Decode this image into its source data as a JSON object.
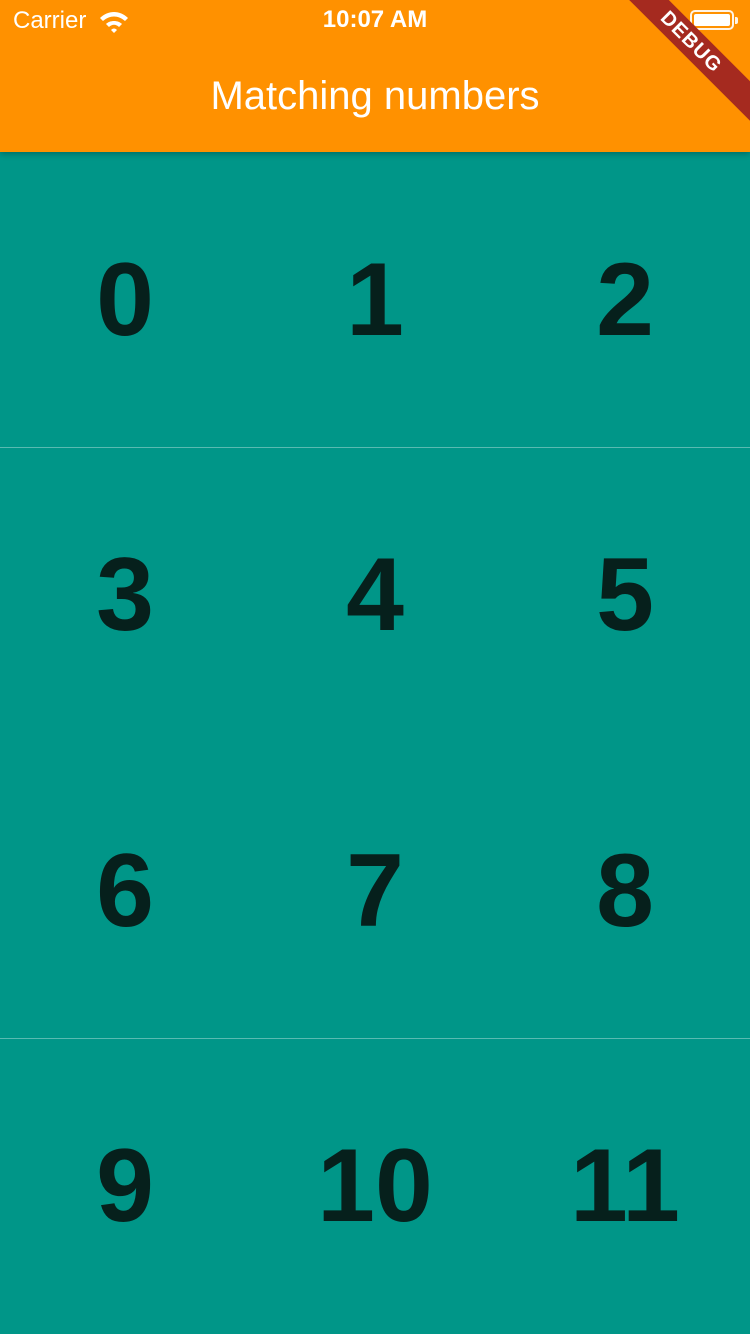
{
  "status_bar": {
    "carrier": "Carrier",
    "time": "10:07 AM",
    "wifi_icon": "wifi-icon",
    "battery_icon": "battery-icon"
  },
  "app_bar": {
    "title": "Matching numbers",
    "background_color": "#FF9100",
    "debug_banner": "DEBUG"
  },
  "grid": {
    "background_color": "#009688",
    "text_color": "#06201c",
    "cells": [
      "0",
      "1",
      "2",
      "3",
      "4",
      "5",
      "6",
      "7",
      "8",
      "9",
      "10",
      "11"
    ]
  }
}
